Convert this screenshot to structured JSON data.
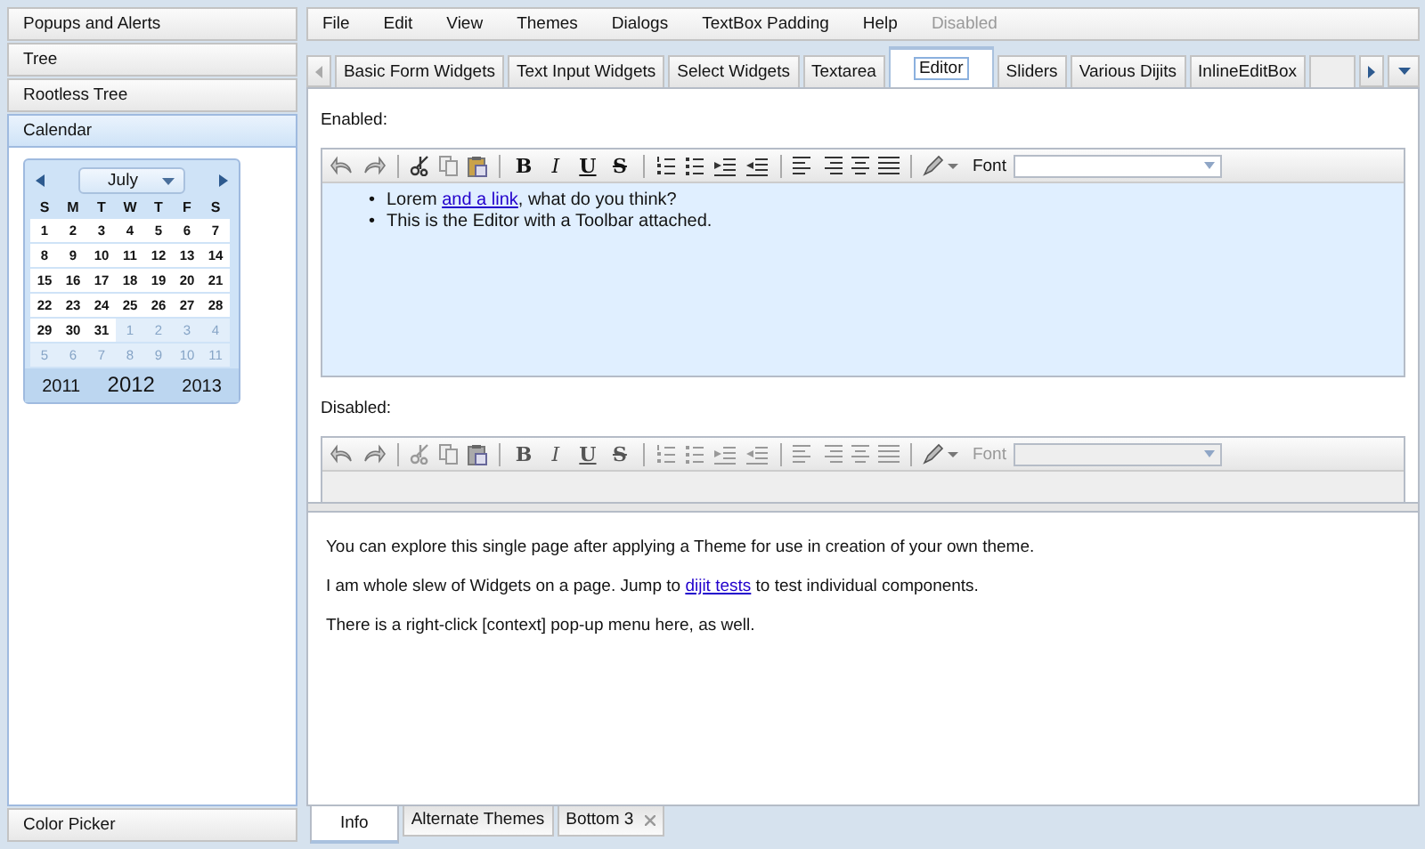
{
  "accordion": {
    "panes": [
      {
        "title": "Popups and Alerts",
        "selected": false
      },
      {
        "title": "Tree",
        "selected": false
      },
      {
        "title": "Rootless Tree",
        "selected": false
      },
      {
        "title": "Calendar",
        "selected": true
      }
    ],
    "bottom_pane": {
      "title": "Color Picker",
      "selected": false
    }
  },
  "calendar": {
    "month": "July",
    "weekdays": [
      "S",
      "M",
      "T",
      "W",
      "T",
      "F",
      "S"
    ],
    "weeks": [
      [
        {
          "day": "1",
          "current": true
        },
        {
          "day": "2",
          "current": true
        },
        {
          "day": "3",
          "current": true
        },
        {
          "day": "4",
          "current": true
        },
        {
          "day": "5",
          "current": true
        },
        {
          "day": "6",
          "current": true
        },
        {
          "day": "7",
          "current": true
        }
      ],
      [
        {
          "day": "8",
          "current": true
        },
        {
          "day": "9",
          "current": true
        },
        {
          "day": "10",
          "current": true
        },
        {
          "day": "11",
          "current": true
        },
        {
          "day": "12",
          "current": true
        },
        {
          "day": "13",
          "current": true
        },
        {
          "day": "14",
          "current": true
        }
      ],
      [
        {
          "day": "15",
          "current": true
        },
        {
          "day": "16",
          "current": true
        },
        {
          "day": "17",
          "current": true
        },
        {
          "day": "18",
          "current": true
        },
        {
          "day": "19",
          "current": true
        },
        {
          "day": "20",
          "current": true
        },
        {
          "day": "21",
          "current": true
        }
      ],
      [
        {
          "day": "22",
          "current": true
        },
        {
          "day": "23",
          "current": true
        },
        {
          "day": "24",
          "current": true
        },
        {
          "day": "25",
          "current": true
        },
        {
          "day": "26",
          "current": true
        },
        {
          "day": "27",
          "current": true
        },
        {
          "day": "28",
          "current": true
        }
      ],
      [
        {
          "day": "29",
          "current": true
        },
        {
          "day": "30",
          "current": true
        },
        {
          "day": "31",
          "current": true
        },
        {
          "day": "1",
          "current": false
        },
        {
          "day": "2",
          "current": false
        },
        {
          "day": "3",
          "current": false
        },
        {
          "day": "4",
          "current": false
        }
      ],
      [
        {
          "day": "5",
          "current": false
        },
        {
          "day": "6",
          "current": false
        },
        {
          "day": "7",
          "current": false
        },
        {
          "day": "8",
          "current": false
        },
        {
          "day": "9",
          "current": false
        },
        {
          "day": "10",
          "current": false
        },
        {
          "day": "11",
          "current": false
        }
      ]
    ],
    "years": [
      {
        "label": "2011",
        "selected": false
      },
      {
        "label": "2012",
        "selected": true
      },
      {
        "label": "2013",
        "selected": false
      }
    ]
  },
  "menu": [
    {
      "label": "File",
      "disabled": false
    },
    {
      "label": "Edit",
      "disabled": false
    },
    {
      "label": "View",
      "disabled": false
    },
    {
      "label": "Themes",
      "disabled": false
    },
    {
      "label": "Dialogs",
      "disabled": false
    },
    {
      "label": "TextBox Padding",
      "disabled": false
    },
    {
      "label": "Help",
      "disabled": false
    },
    {
      "label": "Disabled",
      "disabled": true
    }
  ],
  "tabs": [
    {
      "label": "Basic Form Widgets",
      "selected": false
    },
    {
      "label": "Text Input Widgets",
      "selected": false
    },
    {
      "label": "Select Widgets",
      "selected": false
    },
    {
      "label": "Textarea",
      "selected": false
    },
    {
      "label": "Editor",
      "selected": true
    },
    {
      "label": "Sliders",
      "selected": false
    },
    {
      "label": "Various Dijits",
      "selected": false
    },
    {
      "label": "InlineEditBox",
      "selected": false
    }
  ],
  "editors": [
    {
      "label": "Enabled:",
      "disabled": false,
      "format_buttons": [
        "B",
        "I",
        "U",
        "S"
      ],
      "font_label": "Font",
      "items": [
        {
          "bullet": "•",
          "before": "Lorem ",
          "link": "and a link",
          "after": ", what do you think?"
        },
        {
          "bullet": "•",
          "before": "This is the Editor with a Toolbar attached."
        }
      ]
    },
    {
      "label": "Disabled:",
      "disabled": true,
      "format_buttons": [
        "B",
        "I",
        "U",
        "S"
      ],
      "font_label": "Font"
    }
  ],
  "info": [
    {
      "before": "You can explore this single page after applying a Theme for use in creation of your own theme."
    },
    {
      "before": "I am whole slew of Widgets on a page. Jump to ",
      "link": "dijit tests",
      "after": " to test individual components."
    },
    {
      "before": "There is a right-click [context] pop-up menu here, as well."
    }
  ],
  "bottom_tabs": [
    {
      "label": "Info",
      "selected": true,
      "closable": false
    },
    {
      "label": "Alternate Themes",
      "selected": false,
      "closable": false
    },
    {
      "label": "Bottom 3",
      "selected": false,
      "closable": true
    }
  ]
}
